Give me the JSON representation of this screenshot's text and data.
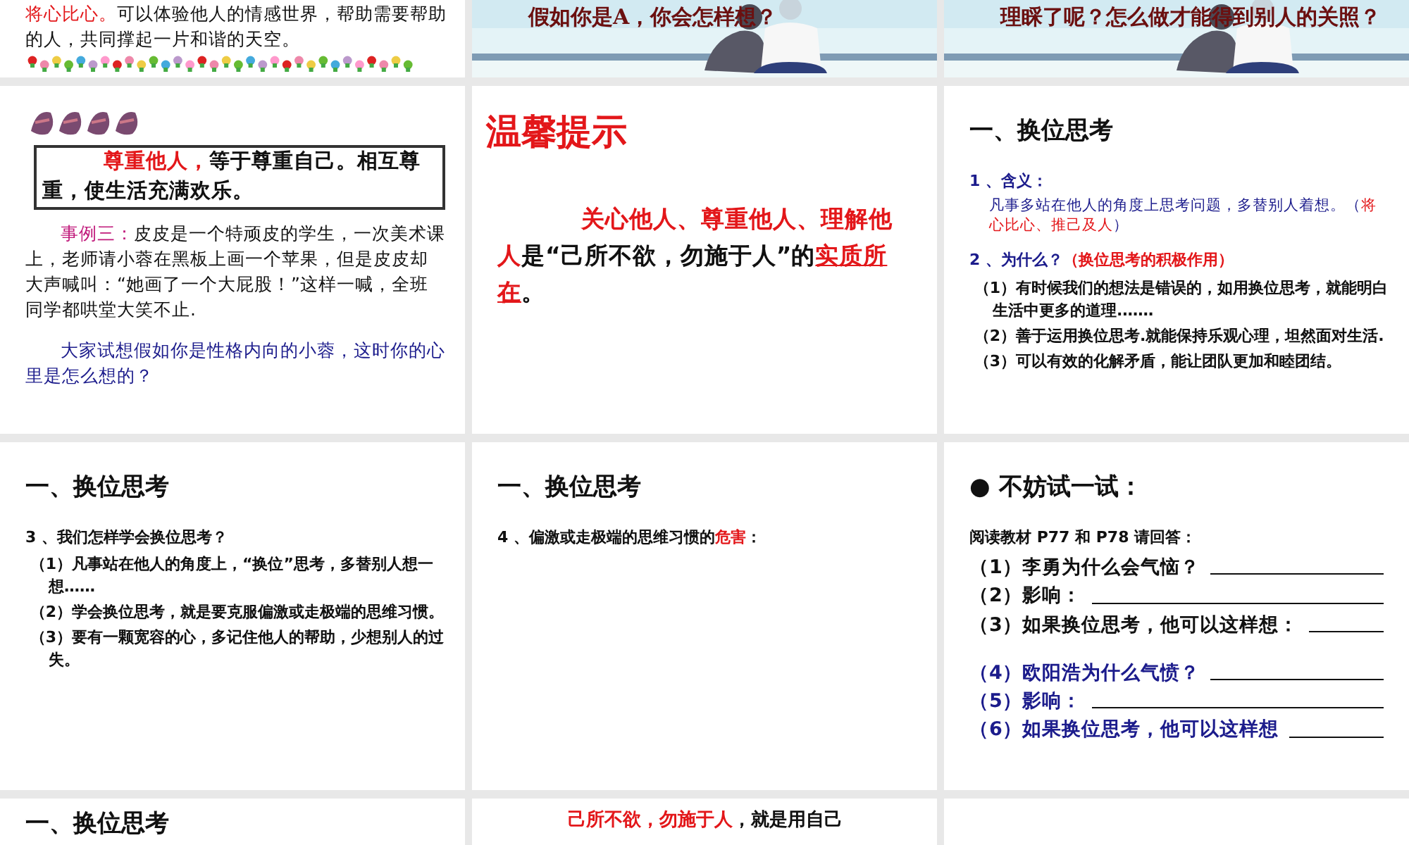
{
  "slides": [
    {
      "kind": "text",
      "blocks": [
        {
          "kind": "para",
          "parts": [
            {
              "text": "将心比心。",
              "kind": "red"
            },
            {
              "text": "可以体验他人的情感世界，帮助需要帮助的人，共同撑起一片和谐的天空。",
              "kind": "plain"
            }
          ]
        },
        {
          "kind": "flowers"
        }
      ]
    },
    {
      "blocks": [
        {
          "kind": "caption",
          "parts": [
            {
              "text": "假如你是A，你会怎样想？",
              "kind": "darkred"
            }
          ]
        }
      ]
    },
    {
      "blocks": [
        {
          "kind": "caption",
          "parts": [
            {
              "text": "理睬了呢？怎么做才能得到别人的关照？",
              "kind": "darkred"
            }
          ]
        }
      ]
    },
    {
      "kind": "text",
      "blocks": [
        {
          "kind": "title-art"
        },
        {
          "kind": "boxed",
          "parts": [
            {
              "text": "尊重他人，",
              "kind": "red"
            },
            {
              "text": "等于尊重自己。相互尊重，使生活充满欢乐。",
              "kind": "plain"
            }
          ]
        },
        {
          "kind": "para",
          "parts": [
            {
              "text": "事例三：",
              "kind": "magenta"
            },
            {
              "text": "皮皮是一个特顽皮的学生，一次美术课上，老师请小蓉在黑板上画一个苹果，但是皮皮却大声喊叫：“她画了一个大屁股！”这样一喊，全班同学都哄堂大笑不止.",
              "kind": "plain"
            }
          ]
        },
        {
          "kind": "para",
          "parts": [
            {
              "text": "大家试想假如你是性格内向的小蓉，这时你的心里是怎么想的？",
              "kind": "blue"
            }
          ]
        }
      ]
    },
    {
      "kind": "text",
      "blocks": [
        {
          "kind": "banner",
          "parts": [
            {
              "text": "温馨提示",
              "kind": "red"
            }
          ]
        },
        {
          "kind": "big",
          "parts": [
            {
              "text": "关心他人、尊重他人、理解他人",
              "kind": "red"
            },
            {
              "text": "是“己所不欲，勿施于人”的",
              "kind": "plain"
            },
            {
              "text": "实质所在",
              "kind": "red-underline"
            },
            {
              "text": "。",
              "kind": "plain"
            }
          ]
        }
      ]
    },
    {
      "kind": "text",
      "blocks": [
        {
          "kind": "heading",
          "parts": [
            {
              "text": "一、换位思考",
              "kind": "plain"
            }
          ]
        },
        {
          "kind": "label",
          "parts": [
            {
              "text": "1 、含义：",
              "kind": "blue"
            }
          ]
        },
        {
          "kind": "note",
          "parts": [
            {
              "text": "凡事多站在他人的角度上思考问题，多替别人着想。（",
              "kind": "blue"
            },
            {
              "text": "将心比心、推己及人",
              "kind": "red"
            },
            {
              "text": "）",
              "kind": "blue"
            }
          ]
        },
        {
          "kind": "label",
          "parts": [
            {
              "text": "2 、为什么？",
              "kind": "blue"
            },
            {
              "text": "（换位思考的积极作用）",
              "kind": "red"
            }
          ]
        },
        {
          "kind": "item",
          "parts": [
            {
              "text": "（1）有时候我们的想法是错误的，如用换位思考，就能明白生活中更多的道理.……",
              "kind": "plain"
            }
          ]
        },
        {
          "kind": "item",
          "parts": [
            {
              "text": "（2）善于运用换位思考.就能保持乐观心理，坦然面对生活.",
              "kind": "plain"
            }
          ]
        },
        {
          "kind": "item",
          "parts": [
            {
              "text": "（3）可以有效的化解矛盾，能让团队更加和睦团结。",
              "kind": "plain"
            }
          ]
        }
      ]
    },
    {
      "kind": "text",
      "blocks": [
        {
          "kind": "heading",
          "parts": [
            {
              "text": "一、换位思考",
              "kind": "plain"
            }
          ]
        },
        {
          "kind": "label",
          "parts": [
            {
              "text": "3 、我们怎样学会换位思考？",
              "kind": "plain"
            }
          ]
        },
        {
          "kind": "item",
          "parts": [
            {
              "text": "（1）凡事站在他人的角度上，“换位”思考，多替别人想一想……",
              "kind": "plain"
            }
          ]
        },
        {
          "kind": "item",
          "parts": [
            {
              "text": "（2）学会换位思考，就是要克服偏激或走极端的思维习惯。",
              "kind": "plain"
            }
          ]
        },
        {
          "kind": "item",
          "parts": [
            {
              "text": "（3）要有一颗宽容的心，多记住他人的帮助，少想别人的过失。",
              "kind": "plain"
            }
          ]
        }
      ]
    },
    {
      "kind": "text",
      "blocks": [
        {
          "kind": "heading",
          "parts": [
            {
              "text": "一、换位思考",
              "kind": "plain"
            }
          ]
        },
        {
          "kind": "label",
          "parts": [
            {
              "text": "4 、偏激或走极端的思维习惯的",
              "kind": "plain"
            },
            {
              "text": "危害",
              "kind": "red"
            },
            {
              "text": "：",
              "kind": "plain"
            }
          ]
        }
      ]
    },
    {
      "kind": "text",
      "blocks": [
        {
          "kind": "heading",
          "parts": [
            {
              "text": "● 不妨试一试：",
              "kind": "plain"
            }
          ]
        },
        {
          "kind": "label",
          "parts": [
            {
              "text": "阅读教材 P77 和 P78 请回答：",
              "kind": "plain"
            }
          ]
        },
        {
          "kind": "answer",
          "parts": [
            {
              "text": "（1）李勇为什么会气恼？",
              "kind": "plain"
            }
          ]
        },
        {
          "kind": "answer",
          "parts": [
            {
              "text": "（2）影响：",
              "kind": "plain"
            }
          ]
        },
        {
          "kind": "answer",
          "parts": [
            {
              "text": "（3）如果换位思考，他可以这样想：",
              "kind": "plain"
            }
          ]
        },
        {
          "kind": "answer",
          "parts": [
            {
              "text": "（4）欧阳浩为什么气愤？",
              "kind": "blue"
            }
          ]
        },
        {
          "kind": "answer",
          "parts": [
            {
              "text": "（5）影响：",
              "kind": "blue"
            }
          ]
        },
        {
          "kind": "answer",
          "parts": [
            {
              "text": "（6）如果换位思考，他可以这样想",
              "kind": "blue"
            }
          ]
        }
      ]
    },
    {
      "kind": "text",
      "blocks": [
        {
          "kind": "heading",
          "parts": [
            {
              "text": "一、换位思考",
              "kind": "plain"
            }
          ]
        }
      ]
    },
    {
      "kind": "text",
      "blocks": [
        {
          "kind": "right",
          "parts": [
            {
              "text": "己所不欲，勿施于人",
              "kind": "red"
            },
            {
              "text": "，就是用自己",
              "kind": "plain"
            }
          ]
        }
      ]
    },
    {
      "kind": "text"
    }
  ]
}
